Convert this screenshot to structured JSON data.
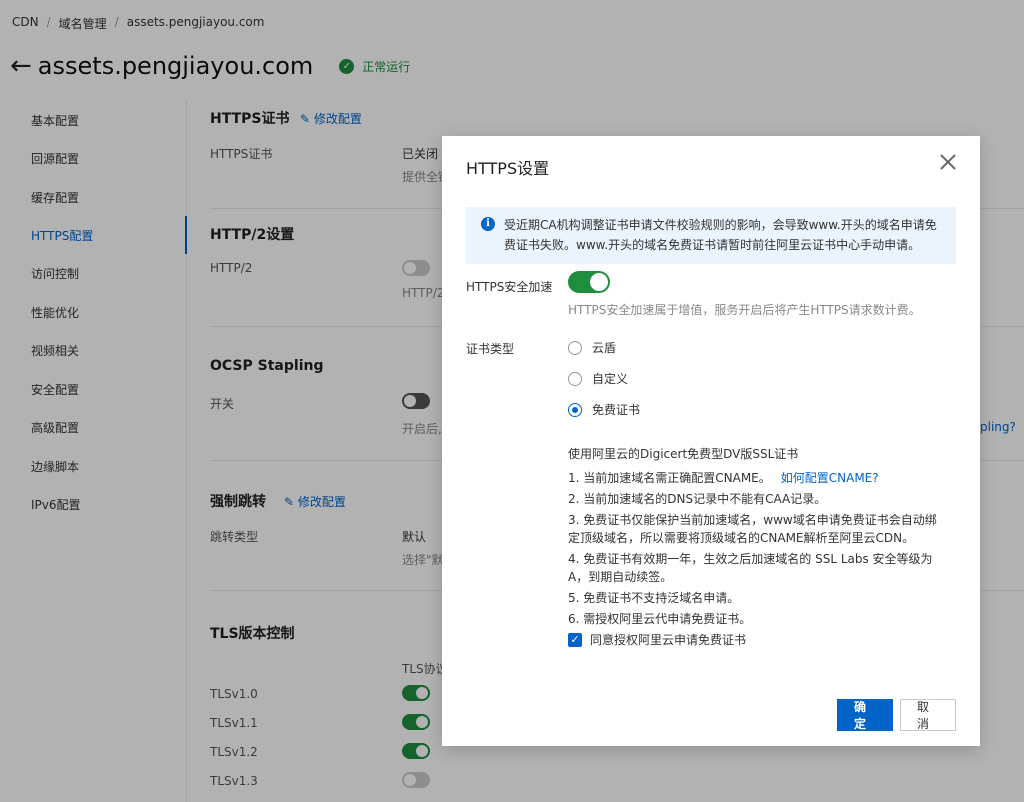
{
  "breadcrumb": {
    "root": "CDN",
    "section": "域名管理",
    "current": "assets.pengjiayou.com",
    "separator": "/"
  },
  "header": {
    "back_icon": "←",
    "domain": "assets.pengjiayou.com",
    "status": "正常运行",
    "status_icon": "✓"
  },
  "sidebar": {
    "items": [
      {
        "label": "基本配置"
      },
      {
        "label": "回源配置"
      },
      {
        "label": "缓存配置"
      },
      {
        "label": "HTTPS配置"
      },
      {
        "label": "访问控制"
      },
      {
        "label": "性能优化"
      },
      {
        "label": "视频相关"
      },
      {
        "label": "安全配置"
      },
      {
        "label": "高级配置"
      },
      {
        "label": "边缘脚本"
      },
      {
        "label": "IPv6配置"
      }
    ],
    "active_index": 3
  },
  "content": {
    "https_cert": {
      "title": "HTTPS证书",
      "edit": "修改配置",
      "label": "HTTPS证书",
      "value": "已关闭",
      "desc": "提供全链"
    },
    "http2": {
      "title": "HTTP/2设置",
      "label": "HTTP/2",
      "desc": "HTTP/2"
    },
    "ocsp": {
      "title": "OCSP Stapling",
      "label": "开关",
      "desc": "开启后,",
      "link_tail": "pling?"
    },
    "redirect": {
      "title": "强制跳转",
      "edit": "修改配置",
      "label": "跳转类型",
      "value": "默认",
      "desc": "选择\"默"
    },
    "tls": {
      "title": "TLS版本控制",
      "col_header": "TLS协议",
      "rows": [
        {
          "label": "TLSv1.0",
          "on": true
        },
        {
          "label": "TLSv1.1",
          "on": true
        },
        {
          "label": "TLSv1.2",
          "on": true
        },
        {
          "label": "TLSv1.3",
          "on": false
        }
      ]
    }
  },
  "dialog": {
    "title": "HTTPS设置",
    "close_icon": "close-icon",
    "notice_icon": "i",
    "notice": "受近期CA机构调整证书申请文件校验规则的影响，会导致www.开头的域名申请免费证书失败。www.开头的域名免费证书请暂时前往阿里云证书中心手动申请。",
    "https_accel_label": "HTTPS安全加速",
    "https_accel_on": true,
    "https_accel_desc": "HTTPS安全加速属于增值，服务开启后将产生HTTPS请求数计费。",
    "cert_type_label": "证书类型",
    "cert_options": [
      {
        "label": "云盾",
        "checked": false
      },
      {
        "label": "自定义",
        "checked": false
      },
      {
        "label": "免费证书",
        "checked": true
      }
    ],
    "cert_info_heading": "使用阿里云的Digicert免费型DV版SSL证书",
    "cert_info_items": [
      "1. 当前加速域名需正确配置CNAME。",
      "2. 当前加速域名的DNS记录中不能有CAA记录。",
      "3. 免费证书仅能保护当前加速域名，www域名申请免费证书会自动绑定顶级域名，所以需要将顶级域名的CNAME解析至阿里云CDN。",
      "4. 免费证书有效期一年，生效之后加速域名的 SSL Labs 安全等级为A，到期自动续签。",
      "5. 免费证书不支持泛域名申请。",
      "6. 需授权阿里云代申请免费证书。"
    ],
    "cname_link": "如何配置CNAME?",
    "agree_checked": true,
    "agree_label": "同意授权阿里云申请免费证书",
    "confirm": "确定",
    "cancel": "取消"
  }
}
